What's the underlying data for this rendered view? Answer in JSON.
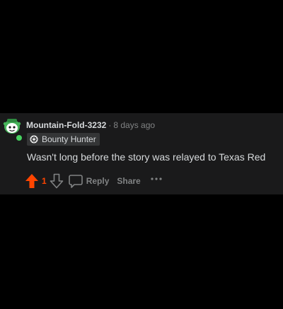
{
  "comment": {
    "author": "Mountain-Fold-3232",
    "separator": "·",
    "timestamp": "8 days ago",
    "flair": {
      "icon": "gear-badge-icon",
      "label": "Bounty Hunter"
    },
    "body": "Wasn't long before the story was relayed to Texas Red",
    "vote_count": "1",
    "upvoted": true,
    "actions": {
      "reply_label": "Reply",
      "share_label": "Share",
      "more_label": "···"
    }
  },
  "colors": {
    "page_background": "#000000",
    "card_background": "#1a1a1b",
    "text_primary": "#d7dadc",
    "text_secondary": "#818384",
    "upvote_active": "#ff4500",
    "online_indicator": "#46d160",
    "flair_background": "#343536"
  },
  "icons": {
    "avatar": "snoo-avatar-icon",
    "upvote": "arrow-up-icon",
    "downvote": "arrow-down-icon",
    "reply": "speech-bubble-icon",
    "more": "ellipsis-icon"
  }
}
